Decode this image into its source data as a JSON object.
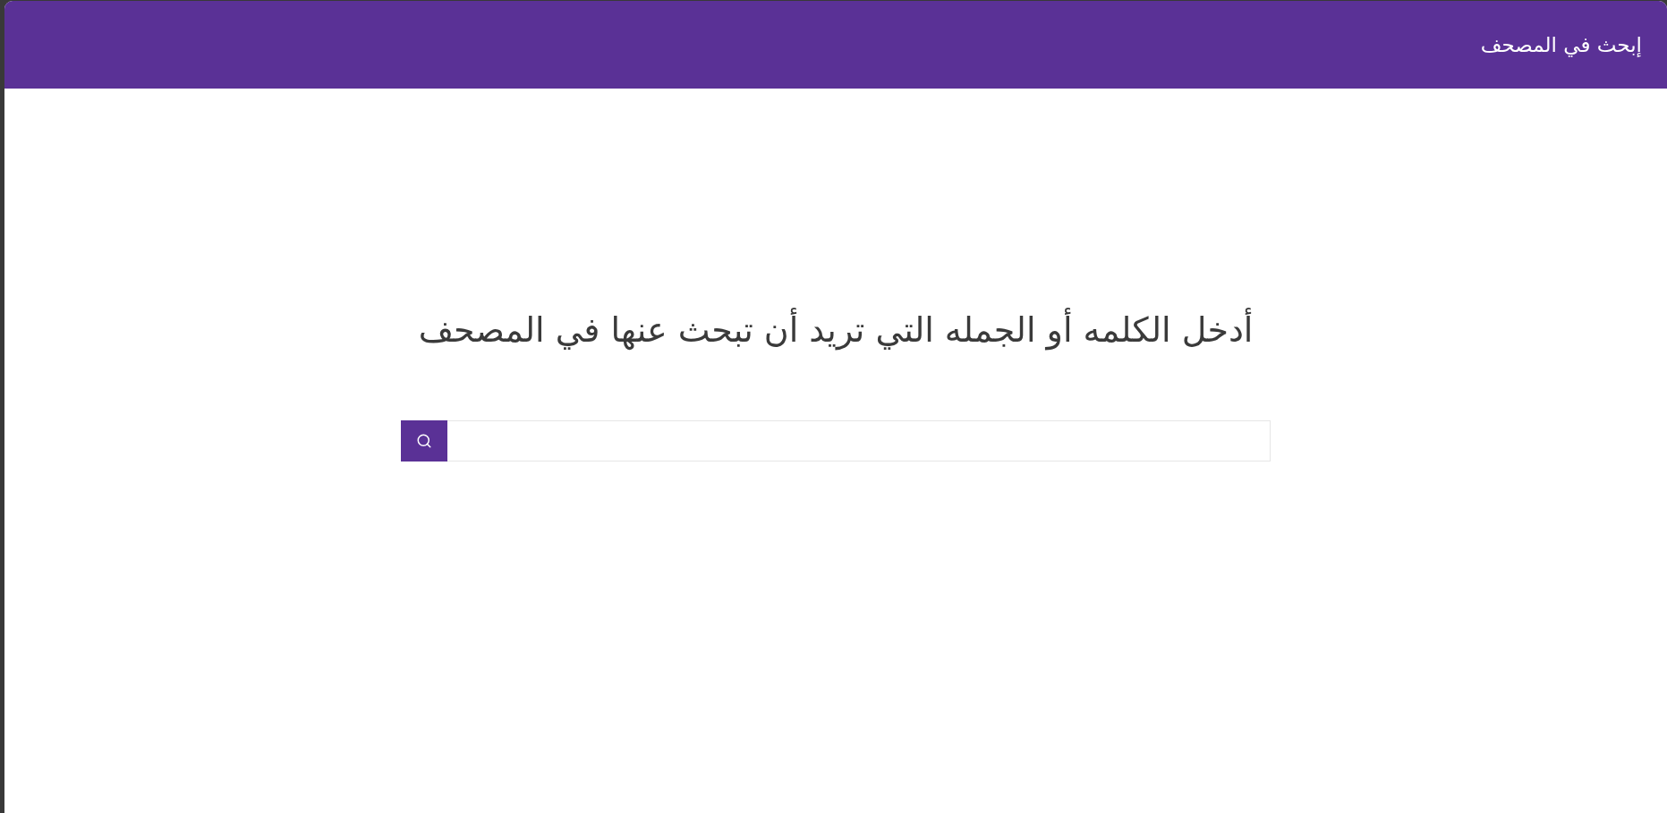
{
  "header": {
    "title": "إبحث في المصحف"
  },
  "main": {
    "heading": "أدخل الكلمه أو الجمله التي تريد أن تبحث عنها في المصحف"
  }
}
